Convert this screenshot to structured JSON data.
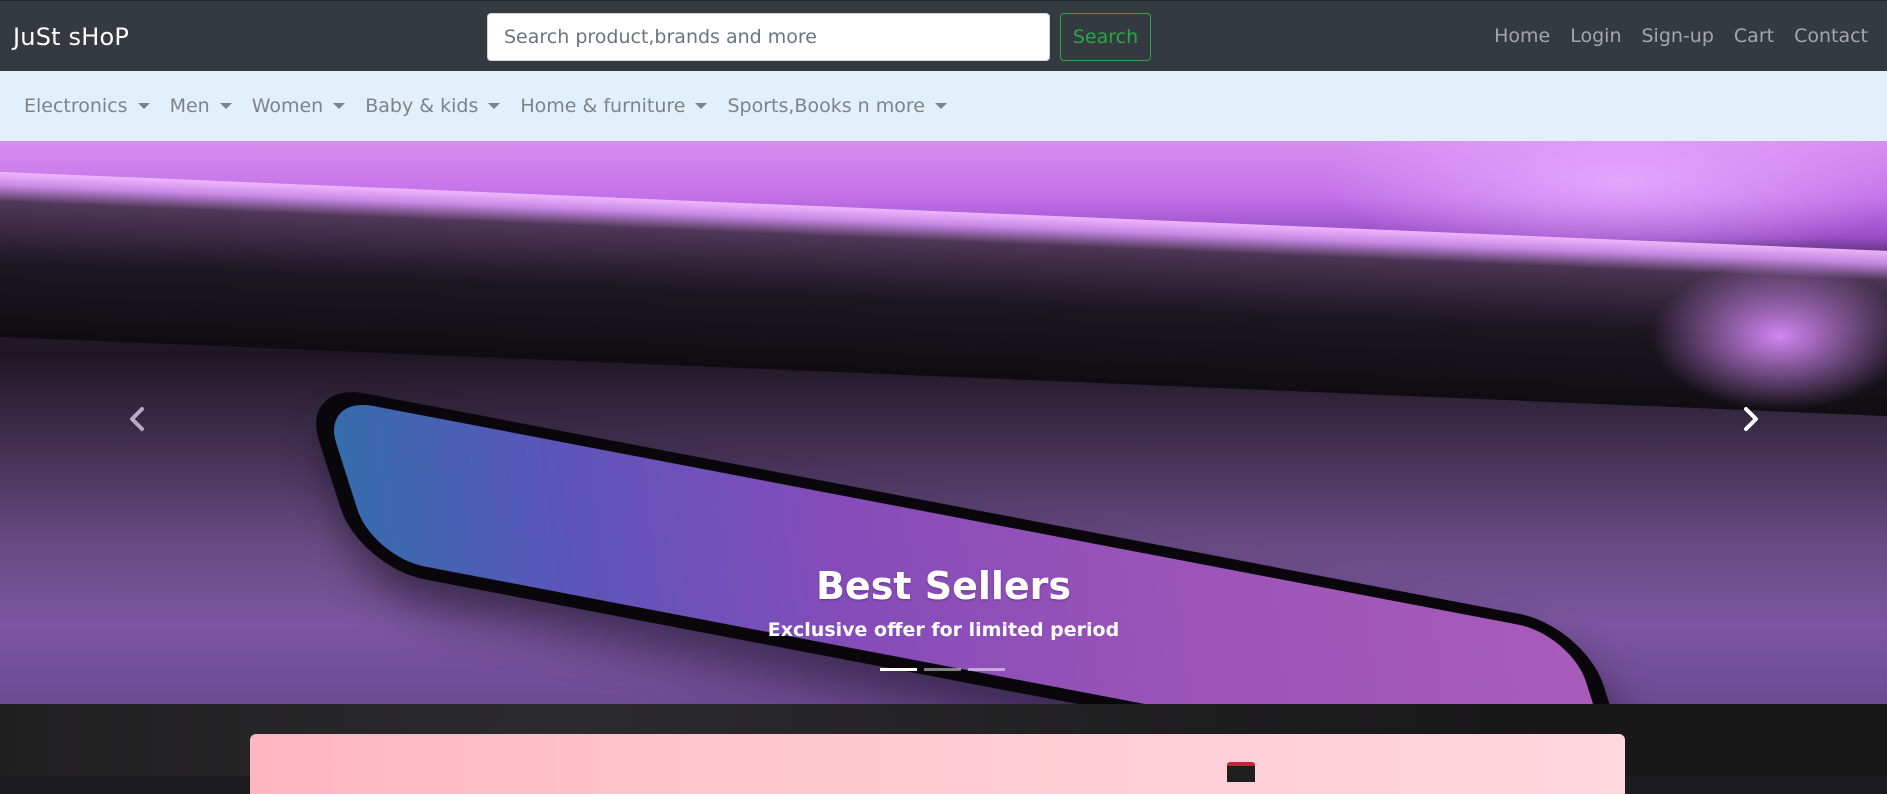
{
  "brand": {
    "name": "JuSt sHoP"
  },
  "search": {
    "placeholder": "Search product,brands and more",
    "value": "",
    "button_label": "Search"
  },
  "top_nav": {
    "links": [
      {
        "label": "Home"
      },
      {
        "label": "Login"
      },
      {
        "label": "Sign-up"
      },
      {
        "label": "Cart"
      },
      {
        "label": "Contact"
      }
    ]
  },
  "categories": [
    {
      "label": "Electronics"
    },
    {
      "label": "Men"
    },
    {
      "label": "Women"
    },
    {
      "label": "Baby & kids"
    },
    {
      "label": "Home & furniture"
    },
    {
      "label": "Sports,Books n more"
    }
  ],
  "carousel": {
    "caption_title": "Best Sellers",
    "caption_text": "Exclusive offer for limited period",
    "slide_count": 3,
    "active_slide": 1
  },
  "colors": {
    "navbar_bg": "#343a40",
    "category_bar_bg": "#e1f0fb",
    "search_button_accent": "#28a745",
    "nav_link_color": "#9a9da0"
  },
  "icons": {
    "prev": "chevron-left-icon",
    "next": "chevron-right-icon",
    "dropdown": "caret-down-icon"
  }
}
